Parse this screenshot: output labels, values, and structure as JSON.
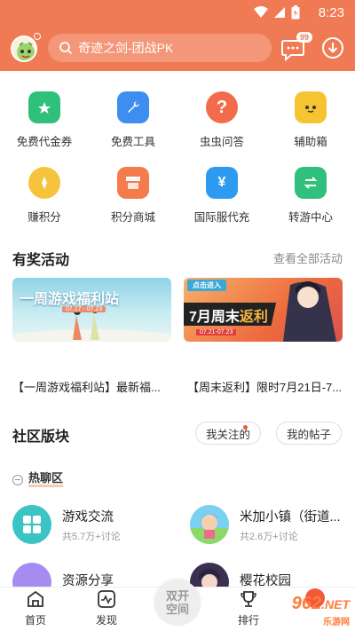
{
  "status": {
    "time": "8:23"
  },
  "header": {
    "search_text": "奇迹之剑-团战PK",
    "badge": "99"
  },
  "quick": [
    {
      "label": "免费代金券",
      "icon": "coupon-icon",
      "color": "#2fc17b"
    },
    {
      "label": "免费工具",
      "icon": "toolbox-icon",
      "color": "#3d8ef0"
    },
    {
      "label": "虫虫问答",
      "icon": "question-icon",
      "color": "#f26b4a"
    },
    {
      "label": "辅助箱",
      "icon": "robot-icon",
      "color": "#f6c431"
    },
    {
      "label": "赚积分",
      "icon": "coin-icon",
      "color": "#f5c43c"
    },
    {
      "label": "积分商城",
      "icon": "shop-icon",
      "color": "#f47b4c"
    },
    {
      "label": "国际服代充",
      "icon": "wallet-icon",
      "color": "#2f9bf0"
    },
    {
      "label": "转游中心",
      "icon": "transfer-icon",
      "color": "#2fc17b"
    }
  ],
  "activities": {
    "title": "有奖活动",
    "view_all": "查看全部活动",
    "banners": [
      {
        "caption": "【一周游戏福利站】最新福...",
        "art_title": "一周游戏福利站",
        "art_date": "07.17 - 07.23"
      },
      {
        "caption": "【周末返利】限时7月21日-7...",
        "art_title_a": "7月",
        "art_title_b": "周末",
        "art_title_c": "返利",
        "art_tag": "点击进入",
        "art_date": "07.21-07.23"
      }
    ]
  },
  "community": {
    "title": "社区版块",
    "pill_following": "我关注的",
    "pill_posts": "我的帖子",
    "hot_label": "热聊区",
    "forums": [
      {
        "name": "游戏交流",
        "meta": "共5.7万+讨论"
      },
      {
        "name": "米加小镇（街道...",
        "meta": "共2.6万+讨论"
      },
      {
        "name": "资源分享",
        "meta": ""
      },
      {
        "name": "樱花校园",
        "meta": ""
      }
    ]
  },
  "tabs": [
    {
      "label": "首页"
    },
    {
      "label": "发现"
    },
    {
      "label": "双开空间"
    },
    {
      "label": "排行"
    },
    {
      "label": ""
    }
  ],
  "watermark": {
    "main": "962",
    "net": ".NET",
    "sub": "乐游网"
  }
}
